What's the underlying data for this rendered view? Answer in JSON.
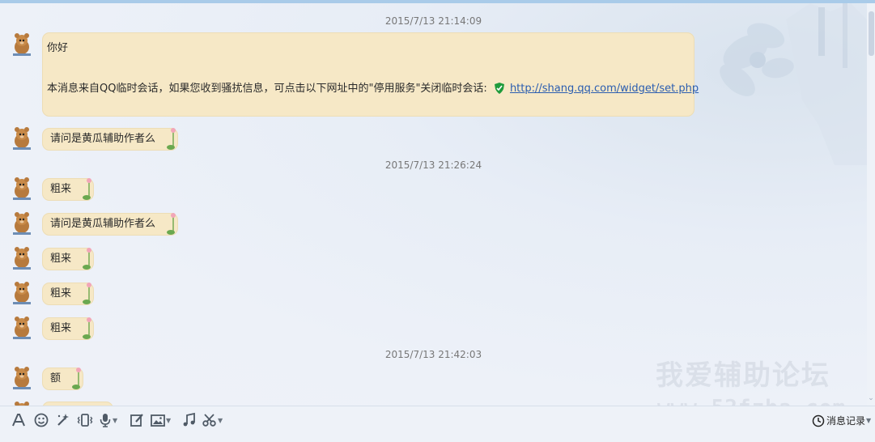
{
  "messages": {
    "ts1": "2015/7/13 21:14:09",
    "ts2": "2015/7/13 21:26:24",
    "ts3": "2015/7/13 21:42:03",
    "system_greeting": "你好",
    "system_notice": "本消息来自QQ临时会话，如果您收到骚扰信息，可点击以下网址中的\"停用服务\"关闭临时会话: ",
    "system_link": "http://shang.qq.com/widget/set.php",
    "m1": "请问是黄瓜辅助作者么",
    "m2": "粗来",
    "m3": "请问是黄瓜辅助作者么",
    "m4": "粗来",
    "m5": "粗来",
    "m6": "粗来",
    "m7": "额"
  },
  "toolbar": {
    "icons": [
      "font-icon",
      "emoji-icon",
      "magic-wand-icon",
      "vibrate-icon",
      "microphone-icon",
      "edit-icon",
      "image-icon",
      "music-icon",
      "scissors-icon",
      "history-clock-icon"
    ],
    "history_label": "消息记录"
  },
  "watermark": {
    "line1": "我爱辅助论坛",
    "line2": "www.52fzba.com"
  },
  "colors": {
    "bubble": "#f6e8c6",
    "link": "#2a5db0",
    "toolbar_bg": "#eef2f8"
  }
}
